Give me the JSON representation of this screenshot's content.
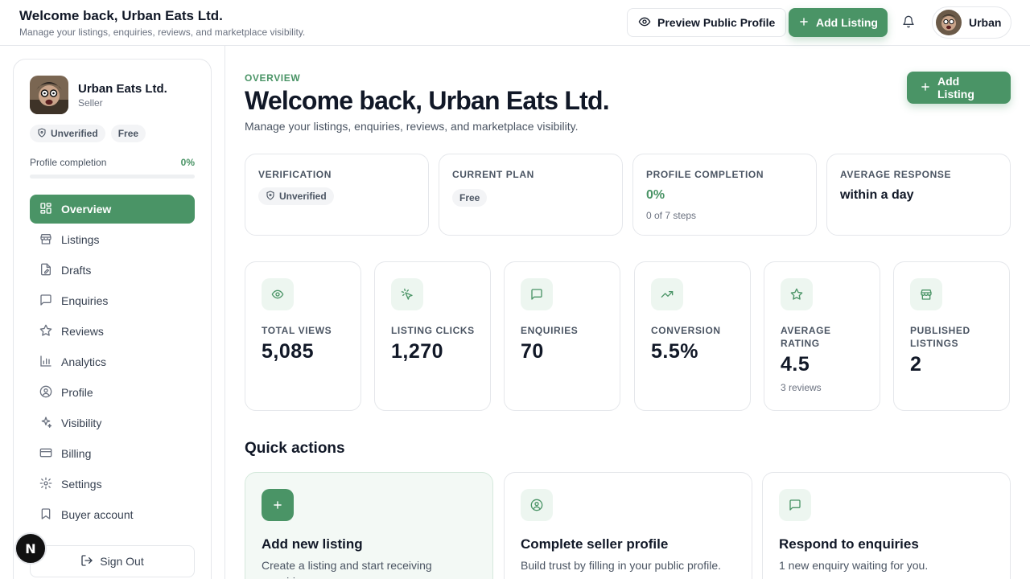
{
  "header": {
    "title": "Welcome back, Urban Eats Ltd.",
    "subtitle": "Manage your listings, enquiries, reviews, and marketplace visibility.",
    "preview_label": "Preview Public Profile",
    "add_listing_label": "Add Listing",
    "user_name": "Urban"
  },
  "sidebar": {
    "name": "Urban Eats Ltd.",
    "role": "Seller",
    "badges": {
      "verification": "Unverified",
      "plan": "Free"
    },
    "completion_label": "Profile completion",
    "completion_value": "0%",
    "completion_fraction": 0,
    "items": [
      {
        "label": "Overview",
        "icon": "grid-icon",
        "active": true
      },
      {
        "label": "Listings",
        "icon": "store-icon"
      },
      {
        "label": "Drafts",
        "icon": "file-edit-icon"
      },
      {
        "label": "Enquiries",
        "icon": "message-icon"
      },
      {
        "label": "Reviews",
        "icon": "star-icon"
      },
      {
        "label": "Analytics",
        "icon": "bar-chart-icon"
      },
      {
        "label": "Profile",
        "icon": "user-circle-icon"
      },
      {
        "label": "Visibility",
        "icon": "sparkles-icon"
      },
      {
        "label": "Billing",
        "icon": "credit-card-icon"
      },
      {
        "label": "Settings",
        "icon": "gear-icon"
      },
      {
        "label": "Buyer account",
        "icon": "bookmark-icon"
      }
    ],
    "sign_out_label": "Sign Out",
    "floating_badge_letter": "N"
  },
  "main": {
    "eyebrow": "OVERVIEW",
    "title": "Welcome back, Urban Eats Ltd.",
    "subtitle": "Manage your listings, enquiries, reviews, and marketplace visibility.",
    "add_listing_label": "Add Listing",
    "info_cards": [
      {
        "label": "VERIFICATION",
        "badge": "Unverified"
      },
      {
        "label": "CURRENT PLAN",
        "badge": "Free"
      },
      {
        "label": "PROFILE COMPLETION",
        "value": "0%",
        "note": "0 of 7 steps"
      },
      {
        "label": "AVERAGE RESPONSE",
        "value": "within a day"
      }
    ],
    "stats": [
      {
        "label": "TOTAL VIEWS",
        "value": "5,085",
        "icon": "eye-icon"
      },
      {
        "label": "LISTING CLICKS",
        "value": "1,270",
        "icon": "pointer-click-icon"
      },
      {
        "label": "ENQUIRIES",
        "value": "70",
        "icon": "message-icon"
      },
      {
        "label": "CONVERSION",
        "value": "5.5%",
        "icon": "trending-up-icon"
      },
      {
        "label": "AVERAGE RATING",
        "value": "4.5",
        "note": "3 reviews",
        "icon": "star-icon"
      },
      {
        "label": "PUBLISHED LISTINGS",
        "value": "2",
        "icon": "store-icon"
      }
    ],
    "quick_actions_title": "Quick actions",
    "quick_actions": [
      {
        "title": "Add new listing",
        "desc": "Create a listing and start receiving enquiries.",
        "icon": "plus-icon"
      },
      {
        "title": "Complete seller profile",
        "desc": "Build trust by filling in your public profile.",
        "icon": "user-circle-icon"
      },
      {
        "title": "Respond to enquiries",
        "desc": "1 new enquiry waiting for you.",
        "icon": "message-icon"
      }
    ]
  },
  "colors": {
    "accent": "#4a9466",
    "accent_soft": "#edf6f0",
    "border": "#e5e7eb",
    "text": "#111827",
    "muted": "#6b7280"
  }
}
